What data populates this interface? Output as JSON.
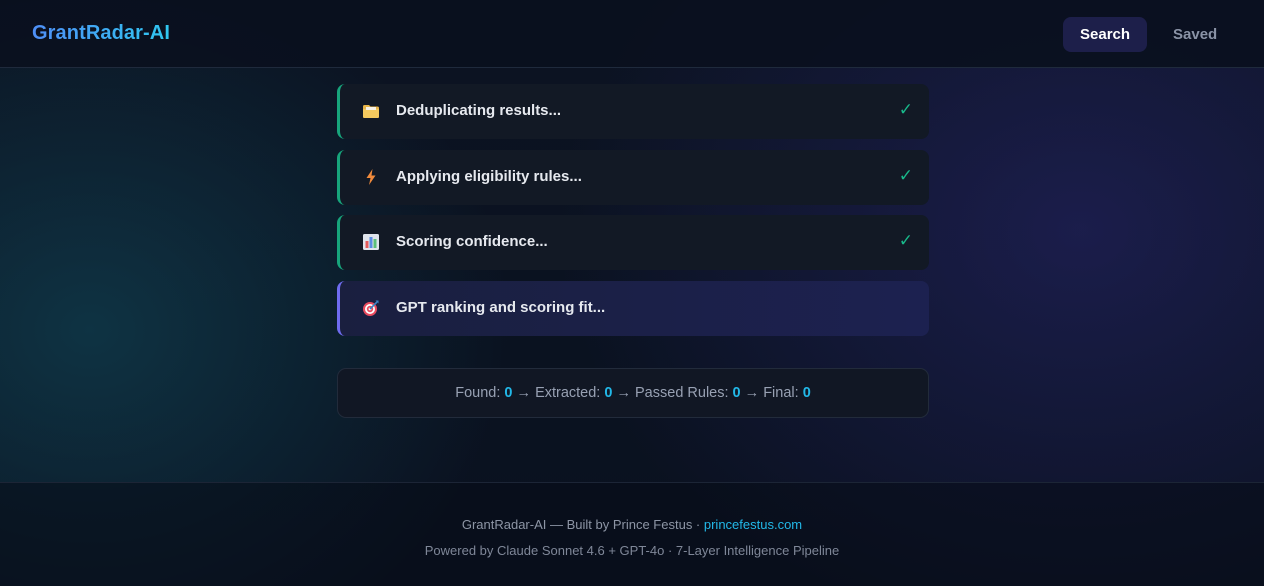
{
  "header": {
    "brand": "GrantRadar-AI",
    "nav": {
      "search_label": "Search",
      "saved_label": "Saved"
    }
  },
  "steps": [
    {
      "icon": "folder-icon",
      "label": "Deduplicating results...",
      "status": "✓"
    },
    {
      "icon": "lightning-icon",
      "label": "Applying eligibility rules...",
      "status": "✓"
    },
    {
      "icon": "bar-chart-icon",
      "label": "Scoring confidence...",
      "status": "✓"
    },
    {
      "icon": "target-icon",
      "label": "GPT ranking and scoring fit...",
      "status": ""
    }
  ],
  "stats": {
    "found_label": "Found:",
    "found_value": "0",
    "extracted_label": "Extracted:",
    "extracted_value": "0",
    "passed_label": "Passed Rules:",
    "passed_value": "0",
    "final_label": "Final:",
    "final_value": "0",
    "arrow": "→"
  },
  "footer": {
    "line1_text": "GrantRadar-AI — Built by Prince Festus · ",
    "line1_link": "princefestus.com",
    "line2": "Powered by Claude Sonnet 4.6 + GPT-4o · 7-Layer Intelligence Pipeline"
  },
  "colors": {
    "accent": "#22b8e8",
    "done": "#17a57c",
    "active": "#6f6cf0"
  }
}
